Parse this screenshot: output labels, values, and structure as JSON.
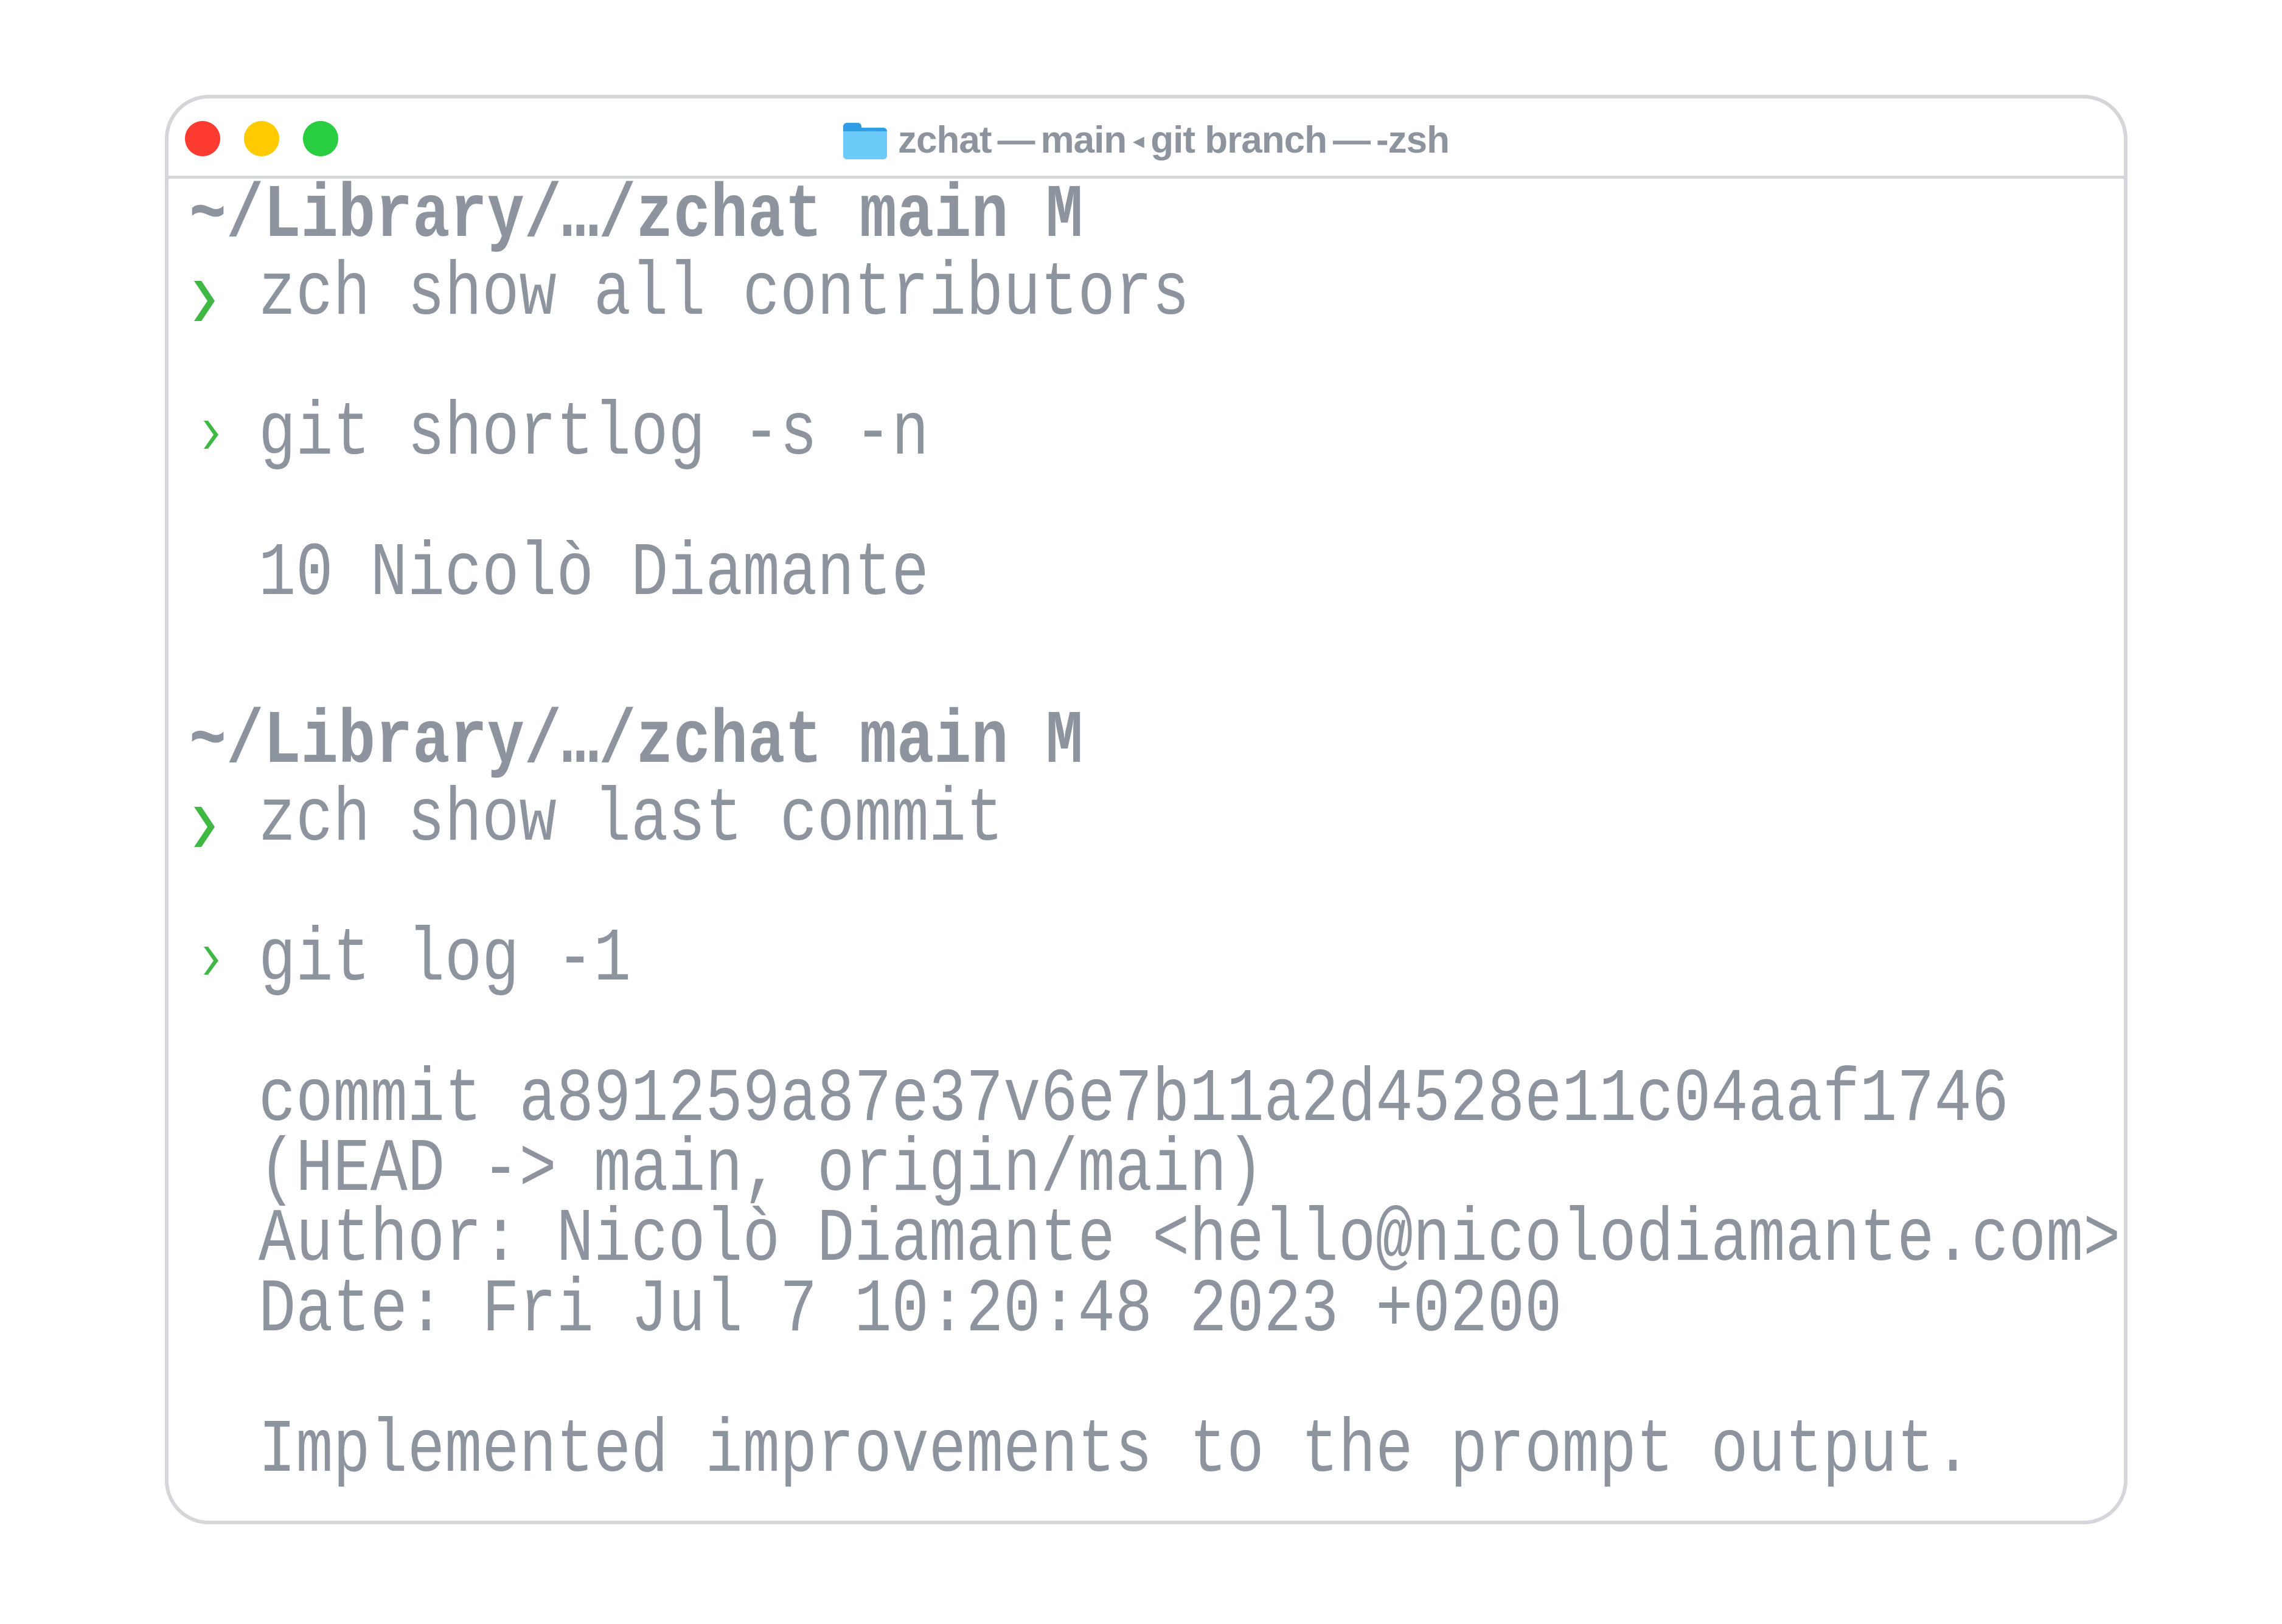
{
  "window": {
    "title_folder": "zchat",
    "title_sep1": "—",
    "title_branch": "main",
    "title_arrow": "◂",
    "title_process": "git branch",
    "title_sep2": "—",
    "title_shell": "-zsh",
    "traffic_lights": {
      "close": "#fe3b30",
      "minimize": "#fecb00",
      "zoom": "#28cd41"
    }
  },
  "colors": {
    "prompt_chevron": "#3fb844",
    "text": "#8e949e",
    "border": "#d4d6da"
  },
  "terminal": {
    "blocks": [
      {
        "path": "~/Library/…/zchat main M",
        "prompt_icon": "chevron-right",
        "request": "zch show all contributors",
        "command": "git shortlog -s -n",
        "output": [
          "10 Nicolò Diamante"
        ]
      },
      {
        "path": "~/Library/…/zchat main M",
        "prompt_icon": "chevron-right",
        "request": "zch show last commit",
        "command": "git log -1",
        "output": [
          "commit a891259a87e37v6e7b11a2d4528e11c04aaf1746",
          "(HEAD -> main, origin/main)",
          "Author: Nicolò Diamante <hello@nicolodiamante.com>",
          "Date: Fri Jul 7 10:20:48 2023 +0200",
          "",
          "Implemented improvements to the prompt output."
        ]
      }
    ]
  }
}
